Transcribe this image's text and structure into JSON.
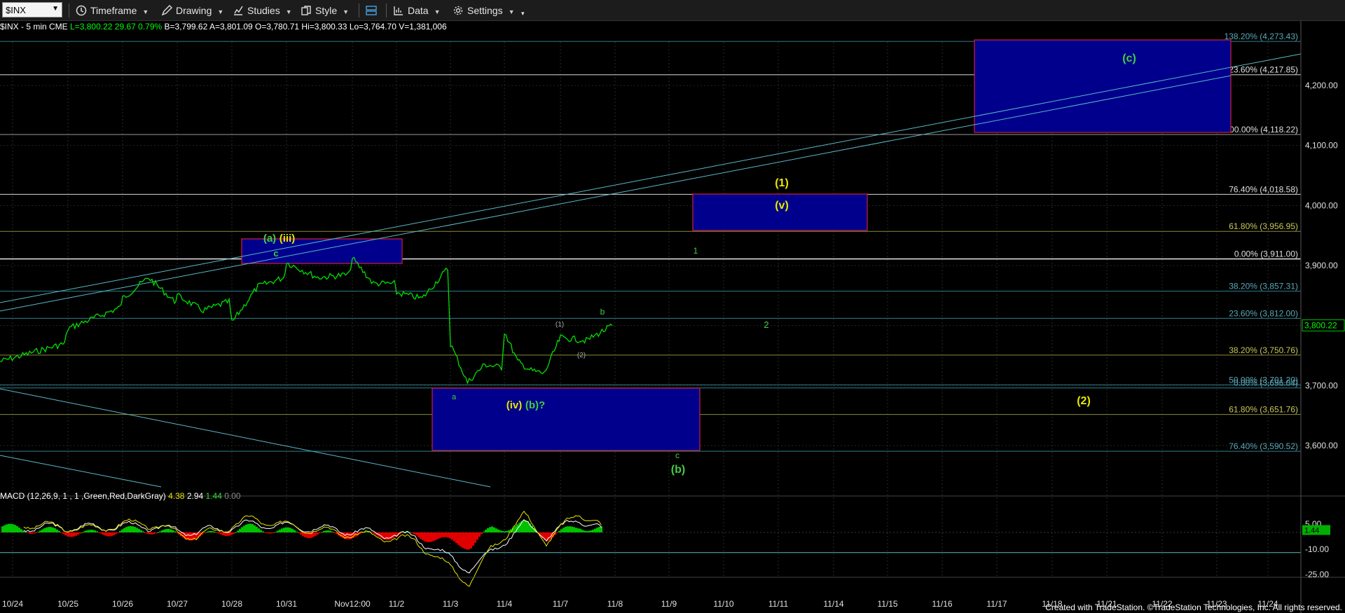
{
  "toolbar": {
    "symbol": "$INX",
    "timeframe": "Timeframe",
    "drawing": "Drawing",
    "studies": "Studies",
    "style": "Style",
    "data": "Data",
    "settings": "Settings"
  },
  "status": {
    "symbol_info": "$INX - 5 min  CME",
    "last": "L=3,800.22",
    "change": "29.67",
    "pct": "0.79%",
    "bid": "B=3,799.62",
    "ask": "A=3,801.09",
    "open": "O=3,780.71",
    "high": "Hi=3,800.33",
    "low": "Lo=3,764.70",
    "volume": "V=1,381,006"
  },
  "macd": {
    "label": "MACD (12,26,9, 1 , 1 ,Green,Red,DarkGray)",
    "v1": "4.38",
    "v2": "2.94",
    "v3": "1.44",
    "v4": "0.00"
  },
  "footer": "Created with TradeStation. ©TradeStation Technologies, Inc. All rights reserved.",
  "colors": {
    "price": "#00e000",
    "box_fill": "#00008c",
    "box_border": "#d0203a",
    "trendline": "#5ab8c8",
    "label_yellow": "#e8e800",
    "label_green": "#44cc44"
  },
  "chart_data": {
    "type": "line",
    "title": "$INX - 5 min",
    "ylim": [
      3530,
      4300
    ],
    "x_tick_labels": [
      "10/24",
      "10/25",
      "10/26",
      "10/27",
      "10/28",
      "10/31",
      "Nov12:00",
      "11/2",
      "11/3",
      "11/4",
      "11/7",
      "11/8",
      "11/9",
      "11/10",
      "11/11",
      "11/14",
      "11/15",
      "11/16",
      "11/17",
      "11/18",
      "11/21",
      "11/22",
      "11/23",
      "11/24"
    ],
    "y_tick_labels": [
      "4,200.00",
      "4,100.00",
      "4,000.00",
      "3,900.00",
      "3,800.00",
      "3,700.00",
      "3,600.00"
    ],
    "last_price_tag": "3,800.22",
    "fib_levels": [
      {
        "label": "138.20% (4,273.43)",
        "value": 4273.43
      },
      {
        "label": "123.60% (4,217.85)",
        "value": 4217.85
      },
      {
        "label": "100.00% (4,118.22)",
        "value": 4118.22
      },
      {
        "label": "76.40% (4,018.58)",
        "value": 4018.58
      },
      {
        "label": "61.80% (3,956.95)",
        "value": 3956.95
      },
      {
        "label": "0.00% (3,911.00)",
        "value": 3911.0
      },
      {
        "label": "38.20% (3,857.31)",
        "value": 3857.31
      },
      {
        "label": "23.60% (3,812.00)",
        "value": 3812.0
      },
      {
        "label": "38.20% (3,750.76)",
        "value": 3750.76
      },
      {
        "label": "50.00% (3,701.20)",
        "value": 3701.2
      },
      {
        "label": "0.00% (3,696.04)",
        "value": 3696.04
      },
      {
        "label": "61.80% (3,651.76)",
        "value": 3651.76
      },
      {
        "label": "76.40% (3,590.52)",
        "value": 3590.52
      }
    ],
    "series": [
      {
        "x": [
          "10/24",
          "10/24",
          "10/25",
          "10/25",
          "10/26",
          "10/26",
          "10/26",
          "10/27",
          "10/27",
          "10/27",
          "10/28",
          "10/28",
          "10/28",
          "10/31",
          "10/31",
          "10/31",
          "Nov12:00",
          "Nov12:00",
          "Nov12:00",
          "11/2",
          "11/2",
          "11/2",
          "11/3",
          "11/3",
          "11/3",
          "11/3",
          "11/4",
          "11/4",
          "11/4",
          "11/4",
          "11/4",
          "11/7",
          "11/7",
          "11/7"
        ],
        "y": [
          3740,
          3770,
          3795,
          3830,
          3845,
          3880,
          3840,
          3850,
          3825,
          3840,
          3805,
          3865,
          3880,
          3905,
          3880,
          3885,
          3912,
          3870,
          3870,
          3855,
          3845,
          3895,
          3770,
          3705,
          3735,
          3730,
          3790,
          3740,
          3725,
          3720,
          3770,
          3780,
          3775,
          3800
        ]
      }
    ],
    "macd_series": {
      "x": [
        "10/24",
        "10/25",
        "10/26",
        "10/27",
        "10/28",
        "10/31",
        "Nov12:00",
        "11/2",
        "11/3",
        "11/3",
        "11/4",
        "11/4",
        "11/7",
        "11/7"
      ],
      "macd": [
        5,
        2,
        6,
        -3,
        8,
        2,
        -2,
        -5,
        -30,
        -10,
        10,
        -5,
        12,
        4.38
      ],
      "signal": [
        3,
        3,
        4,
        0,
        5,
        3,
        0,
        -3,
        -22,
        -12,
        5,
        -2,
        8,
        2.94
      ]
    },
    "macd_ylim": [
      -30,
      15
    ],
    "macd_tick_labels": [
      "5.00",
      "-10.00",
      "-25.00"
    ],
    "macd_value_tag": "1.44",
    "wave_labels": [
      {
        "text": "(a)",
        "color": "green"
      },
      {
        "text": "(iii)",
        "color": "yellow"
      },
      {
        "text": "c",
        "color": "green"
      },
      {
        "text": "a",
        "color": "green"
      },
      {
        "text": "(iv)",
        "color": "yellow"
      },
      {
        "text": "(b)?",
        "color": "green"
      },
      {
        "text": "(1)",
        "color": "gray"
      },
      {
        "text": "(2)",
        "color": "gray"
      },
      {
        "text": "b",
        "color": "green"
      },
      {
        "text": "1",
        "color": "green"
      },
      {
        "text": "2",
        "color": "green"
      },
      {
        "text": "(1)",
        "color": "yellow"
      },
      {
        "text": "(v)",
        "color": "yellow"
      },
      {
        "text": "c",
        "color": "green"
      },
      {
        "text": "(b)",
        "color": "green"
      },
      {
        "text": "(2)",
        "color": "yellow"
      },
      {
        "text": "(c)",
        "color": "green"
      }
    ]
  }
}
